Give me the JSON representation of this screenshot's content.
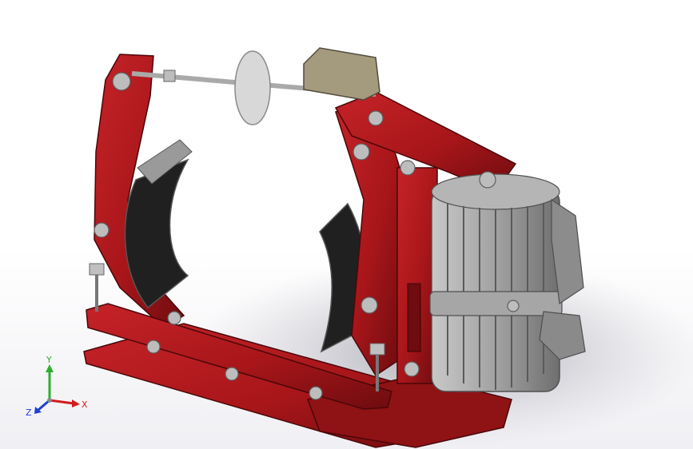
{
  "viewport": {
    "background_color": "#ffffff",
    "model_color": "#a8161a",
    "model_shade_color": "#6e0c0f",
    "motor_color": "#9a9a9a",
    "shoe_lining_color": "#1e1e1e"
  },
  "triad": {
    "x_label": "X",
    "y_label": "Y",
    "z_label": "Z",
    "x_color": "#d21c1c",
    "y_color": "#2bb02b",
    "z_color": "#1f3fd0"
  }
}
